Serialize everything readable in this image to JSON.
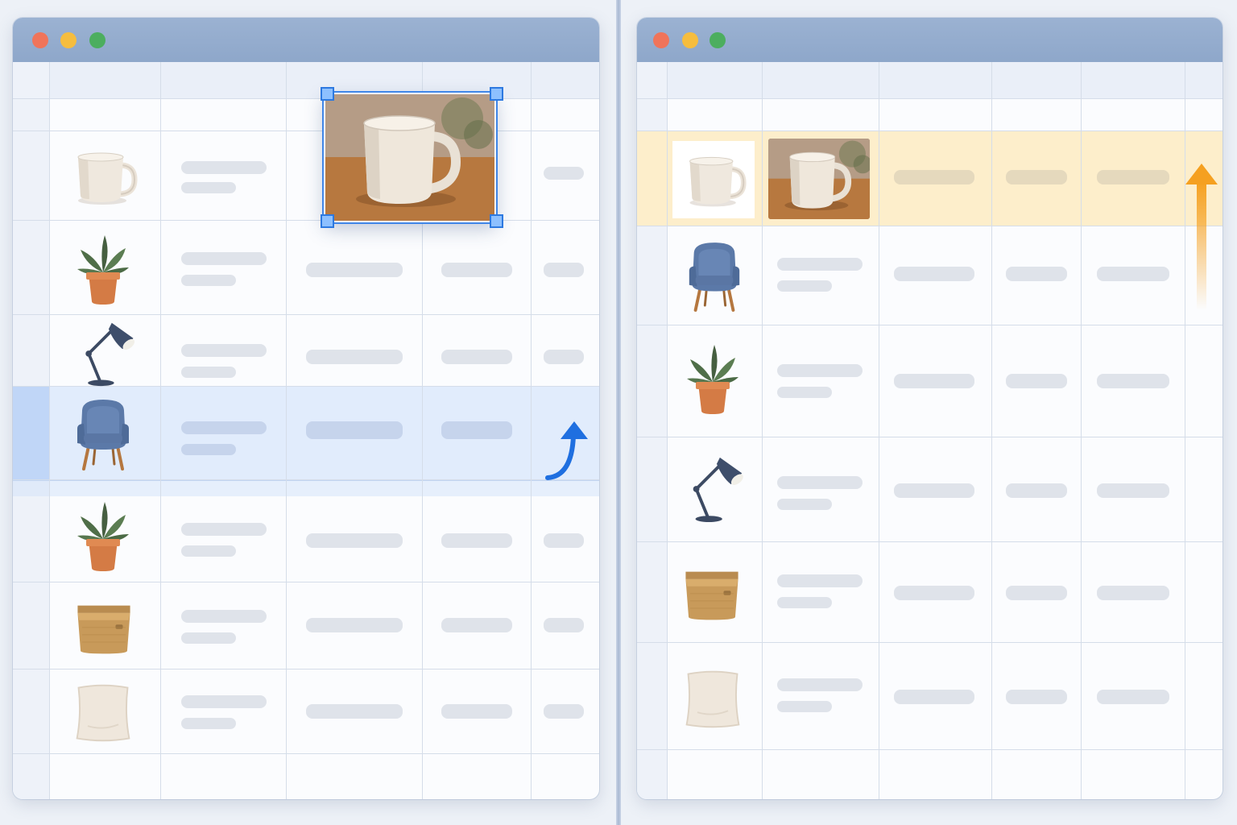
{
  "left_window": {
    "controls": [
      "close",
      "minimize",
      "maximize"
    ],
    "selected_row_index": 3,
    "floating_image": "mug-photo",
    "action_indicator": "arrow-up-icon",
    "rows": [
      {
        "thumbnail": "mug-icon"
      },
      {
        "thumbnail": "potted-plant-icon"
      },
      {
        "thumbnail": "desk-lamp-icon"
      },
      {
        "thumbnail": "armchair-icon"
      },
      {
        "thumbnail": "potted-plant-icon"
      },
      {
        "thumbnail": "storage-basket-icon"
      },
      {
        "thumbnail": "cushion-icon"
      }
    ]
  },
  "right_window": {
    "controls": [
      "close",
      "minimize",
      "maximize"
    ],
    "highlighted_row_index": 0,
    "action_indicator": "arrow-up-icon",
    "rows": [
      {
        "thumbnail": "mug-icon",
        "image": "mug-photo"
      },
      {
        "thumbnail": "armchair-icon"
      },
      {
        "thumbnail": "potted-plant-icon"
      },
      {
        "thumbnail": "desk-lamp-icon"
      },
      {
        "thumbnail": "storage-basket-icon"
      },
      {
        "thumbnail": "cushion-icon"
      }
    ]
  },
  "colors": {
    "titlebar": "#8ea7ca",
    "close": "#f0745a",
    "minimize": "#f6bd3e",
    "maximize": "#4cae5f",
    "selection": "#cddcf6",
    "selection_arrow": "#1f6fe0",
    "highlight": "#fdeecb",
    "highlight_arrow": "#f5a020",
    "placeholder_bar": "#dfe3ea"
  }
}
